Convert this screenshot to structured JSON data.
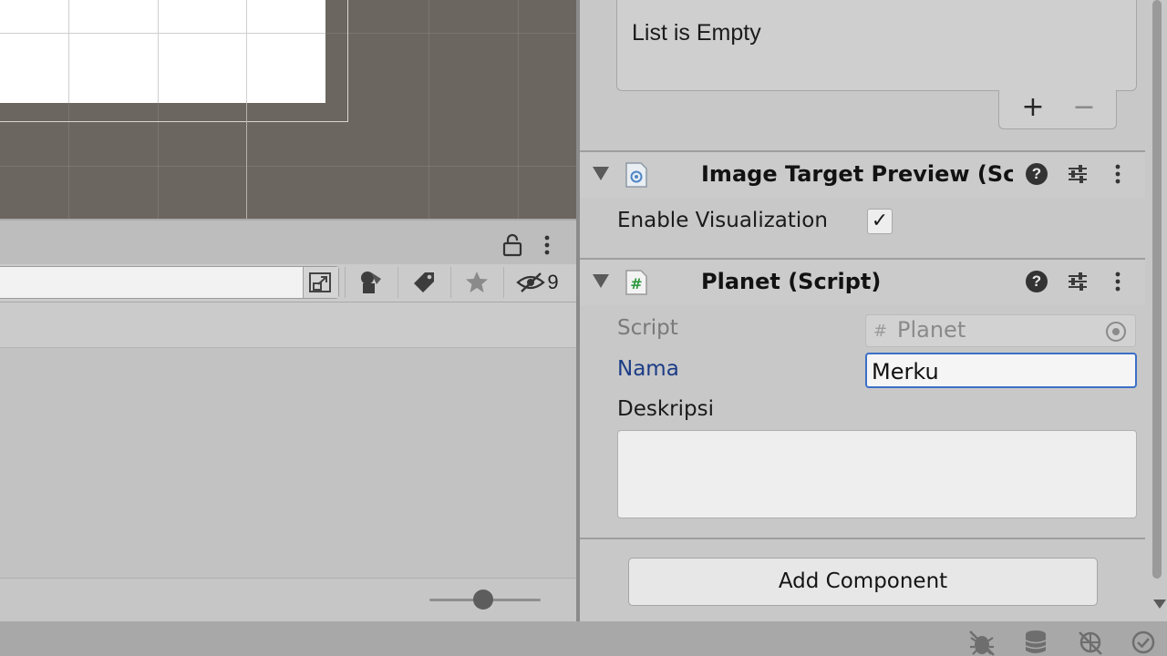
{
  "project_panel": {
    "search": {
      "value": "",
      "placeholder": ""
    },
    "toolbar": {
      "icons": [
        "search-by-type-icon",
        "search-by-label-icon",
        "favorites-icon",
        "hidden-packages-icon"
      ],
      "hidden_packages_count": "9"
    },
    "zoom_slider": {
      "value": 0.48
    }
  },
  "inspector": {
    "list": {
      "empty_text": "List is Empty",
      "add_label": "+",
      "remove_label": "−"
    },
    "components": [
      {
        "title": "Image Target Preview (Script)",
        "icon": "script-asset-icon",
        "fields": {
          "enable_visualization_label": "Enable Visualization",
          "enable_visualization_checked": "✓"
        }
      },
      {
        "title": "Planet (Script)",
        "icon": "csharp-script-icon",
        "fields": {
          "script_label": "Script",
          "script_value": "Planet",
          "nama_label": "Nama",
          "nama_value": "Merku",
          "deskripsi_label": "Deskripsi",
          "deskripsi_value": ""
        }
      }
    ],
    "header_icons": {
      "help": "?"
    },
    "add_component_label": "Add Component"
  },
  "status_bar": {
    "icons": [
      "debug-icon",
      "cache-server-icon",
      "network-icon",
      "progress-check-icon"
    ]
  }
}
